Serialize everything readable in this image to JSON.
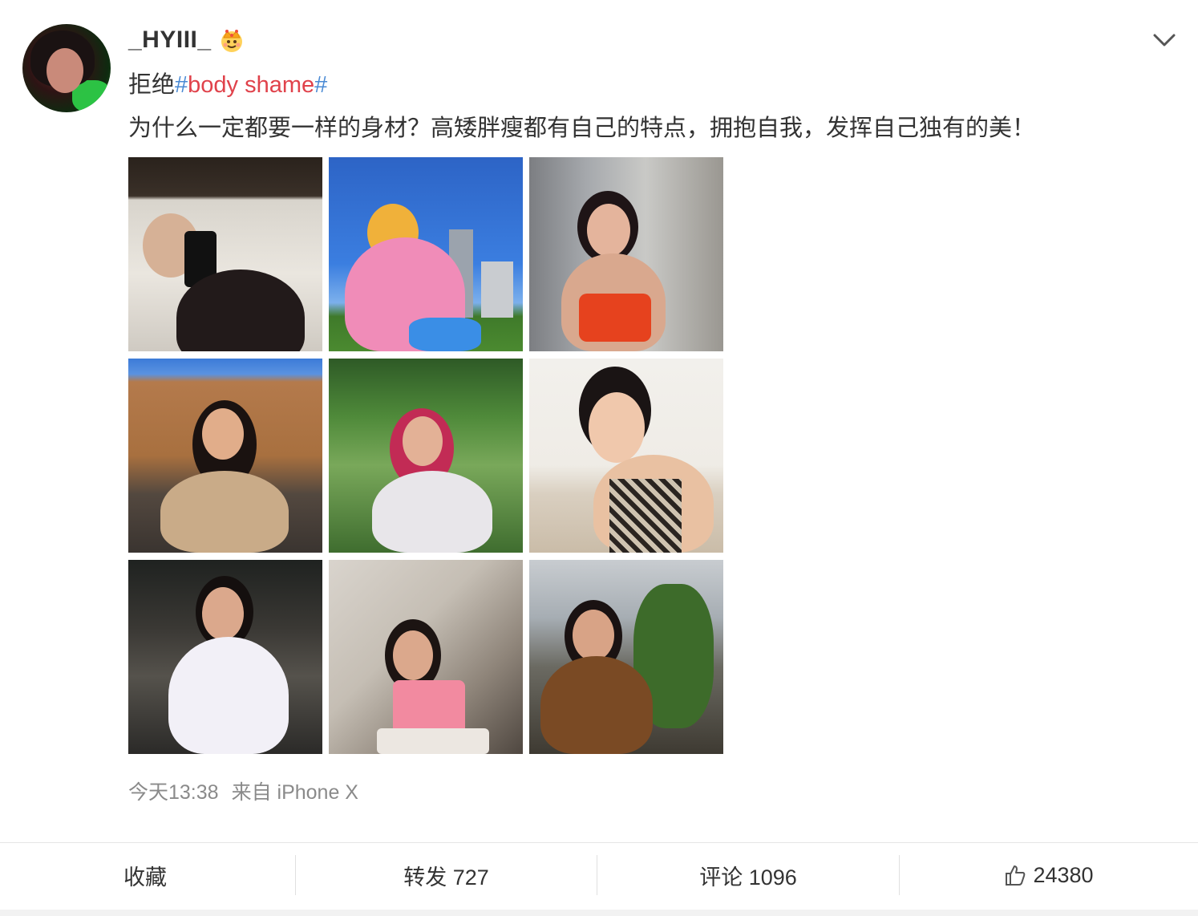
{
  "post": {
    "username": "_HYIII_",
    "badge_icon": "crown-icon",
    "headline_prefix": "拒绝",
    "hashtag_open": "#",
    "hashtag_text": "body shame",
    "hashtag_close": "#",
    "body": "为什么一定都要一样的身材？高矮胖瘦都有自己的特点，拥抱自我，发挥自己独有的美！",
    "photo_count": 9,
    "timestamp": "今天13:38",
    "source": "来自 iPhone X"
  },
  "actions": {
    "favorite": "收藏",
    "repost": "转发 727",
    "comment": "评论 1096",
    "like": "24380"
  },
  "colors": {
    "text": "#333333",
    "meta": "#8a8a8a",
    "hashtag": "#e0424b",
    "hashtag_mark": "#4a8ad4",
    "divider": "#e0e0e0"
  }
}
